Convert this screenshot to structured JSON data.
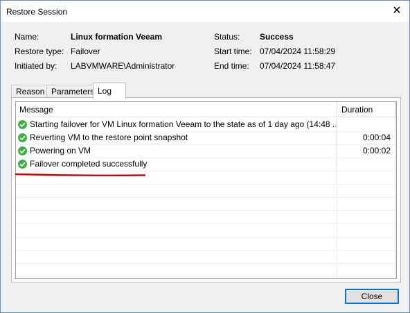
{
  "window": {
    "title": "Restore Session",
    "close_glyph": "✕"
  },
  "info": {
    "name_label": "Name:",
    "name_value": "Linux formation Veeam",
    "type_label": "Restore type:",
    "type_value": "Failover",
    "initiated_label": "Initiated by:",
    "initiated_value": "LABVMWARE\\Administrator",
    "status_label": "Status:",
    "status_value": "Success",
    "start_label": "Start time:",
    "start_value": "07/04/2024 11:58:29",
    "end_label": "End time:",
    "end_value": "07/04/2024 11:58:47"
  },
  "tabs": [
    {
      "label": "Reason"
    },
    {
      "label": "Parameters"
    },
    {
      "label": "Log"
    }
  ],
  "log": {
    "headers": {
      "message": "Message",
      "duration": "Duration"
    },
    "rows": [
      {
        "icon": "success-check-icon",
        "message": "Starting failover for VM Linux formation Veeam to the state as of 1 day ago (14:48 ...",
        "duration": ""
      },
      {
        "icon": "success-check-icon",
        "message": "Reverting VM to the restore point snapshot",
        "duration": "0:00:04"
      },
      {
        "icon": "success-check-icon",
        "message": "Powering on VM",
        "duration": "0:00:02"
      },
      {
        "icon": "success-check-icon",
        "message": "Failover completed successfully",
        "duration": ""
      }
    ]
  },
  "colors": {
    "success": "#3cb043",
    "annotation": "#d60000",
    "accent": "#0078d7"
  },
  "buttons": {
    "close": "Close"
  }
}
